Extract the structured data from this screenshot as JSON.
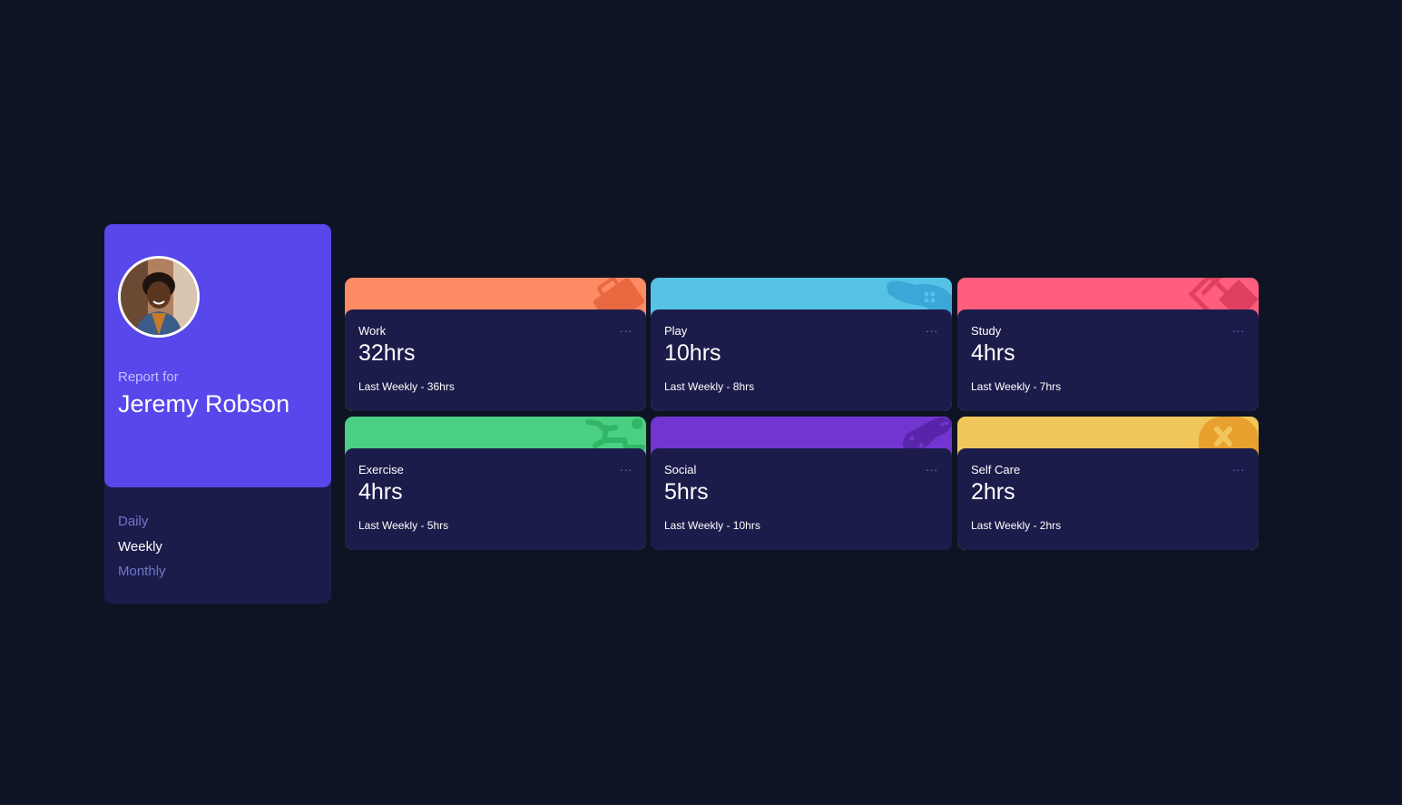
{
  "profile": {
    "report_for": "Report for",
    "name": "Jeremy Robson",
    "avatar_icon": "user-avatar-photo"
  },
  "periods": [
    {
      "label": "Daily",
      "active": false
    },
    {
      "label": "Weekly",
      "active": true
    },
    {
      "label": "Monthly",
      "active": false
    }
  ],
  "cards": [
    {
      "title": "Work",
      "current": "32hrs",
      "previous": "Last Weekly - 36hrs",
      "color": "#ff8b64",
      "icon": "briefcase-icon",
      "menu": "..."
    },
    {
      "title": "Play",
      "current": "10hrs",
      "previous": "Last Weekly - 8hrs",
      "color": "#55c2e6",
      "icon": "gamepad-icon",
      "menu": "..."
    },
    {
      "title": "Study",
      "current": "4hrs",
      "previous": "Last Weekly - 7hrs",
      "color": "#ff5e7d",
      "icon": "book-icon",
      "menu": "..."
    },
    {
      "title": "Exercise",
      "current": "4hrs",
      "previous": "Last Weekly - 5hrs",
      "color": "#4bcf82",
      "icon": "running-icon",
      "menu": "..."
    },
    {
      "title": "Social",
      "current": "5hrs",
      "previous": "Last Weekly - 10hrs",
      "color": "#7335d2",
      "icon": "chat-icon",
      "menu": "..."
    },
    {
      "title": "Self Care",
      "current": "2hrs",
      "previous": "Last Weekly - 2hrs",
      "color": "#f1c75b",
      "icon": "heart-icon",
      "menu": "..."
    }
  ],
  "colors": {
    "background": "#0e1424",
    "panel": "#1c1c4b",
    "profile": "#5847eb",
    "muted_text": "#6f76c8"
  }
}
